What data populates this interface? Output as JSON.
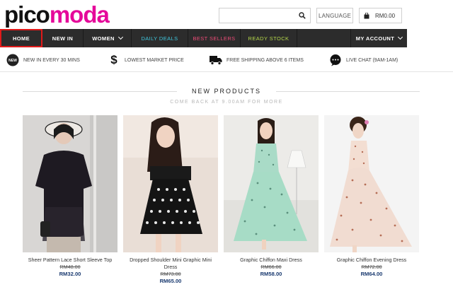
{
  "logo": {
    "part1": "pico",
    "part2": "moda"
  },
  "header": {
    "search_placeholder": "",
    "language_label": "LANGUAGE",
    "cart_total": "RM0.00"
  },
  "nav": {
    "home": "HOME",
    "new_in": "NEW IN",
    "women": "WOMEN",
    "daily_deals": "DAILY DEALS",
    "best_sellers": "BEST SELLERS",
    "ready_stock": "READY STOCK",
    "my_account": "MY ACCOUNT"
  },
  "features": [
    {
      "icon": "new-badge-icon",
      "text": "NEW IN EVERY 30 MINS"
    },
    {
      "icon": "dollar-icon",
      "text": "LOWEST MARKET PRICE"
    },
    {
      "icon": "truck-icon",
      "text": "FREE SHIPPING ABOVE 6 ITEMS"
    },
    {
      "icon": "chat-bubble-icon",
      "text": "LIVE CHAT (9AM-1AM)"
    }
  ],
  "section": {
    "title": "NEW PRODUCTS",
    "subtitle": "COME BACK AT 9.00AM FOR MORE"
  },
  "products": [
    {
      "name": "Sheer Pattern Lace Short Sleeve Top",
      "old_price": "RM48.00",
      "price": "RM32.00"
    },
    {
      "name": "Dropped Shoulder Mini Graphic Mini Dress",
      "old_price": "RM73.00",
      "price": "RM65.00"
    },
    {
      "name": "Graphic Chiffon Maxi Dress",
      "old_price": "RM66.00",
      "price": "RM58.00"
    },
    {
      "name": "Graphic Chiffon Evening Dress",
      "old_price": "RM72.00",
      "price": "RM64.00"
    }
  ],
  "colors": {
    "brand_pink": "#e5099a",
    "nav_bg": "#2c2c2c",
    "daily_deals": "#3fc7de",
    "best_sellers": "#ee4b78",
    "ready_stock": "#b5d74a",
    "price": "#1a3a70",
    "home_highlight": "#e11a1a"
  }
}
